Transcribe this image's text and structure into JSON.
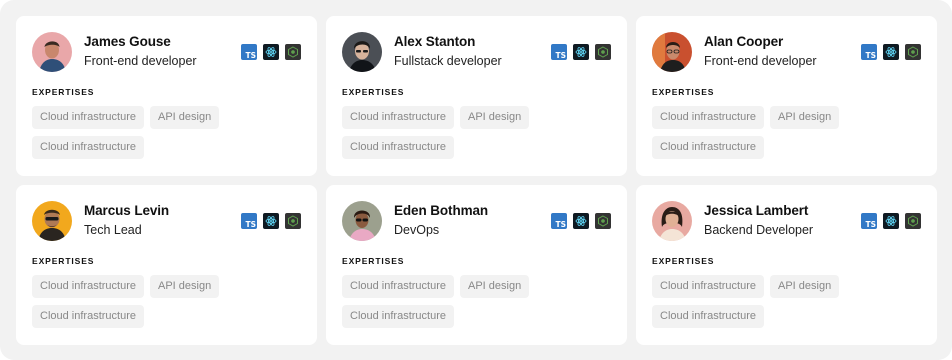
{
  "expertises_heading": "EXPERTISES",
  "tech_stack": [
    {
      "icon": "typescript-icon",
      "label": "TS",
      "color": "#3178c6"
    },
    {
      "icon": "react-icon",
      "color": "#61dafb"
    },
    {
      "icon": "nodejs-icon",
      "color": "#5fa04e"
    }
  ],
  "profiles": [
    {
      "name": "James Gouse",
      "role": "Front-end developer",
      "avatar_bg": "#e9a7a9",
      "expertises": [
        "Cloud infrastructure",
        "API design",
        "Cloud infrastructure"
      ]
    },
    {
      "name": "Alex Stanton",
      "role": "Fullstack developer",
      "avatar_bg": "#4b4f55",
      "expertises": [
        "Cloud infrastructure",
        "API design",
        "Cloud infrastructure"
      ]
    },
    {
      "name": "Alan Cooper",
      "role": "Front-end developer",
      "avatar_bg": "#c9502f",
      "expertises": [
        "Cloud infrastructure",
        "API design",
        "Cloud infrastructure"
      ]
    },
    {
      "name": "Marcus Levin",
      "role": "Tech Lead",
      "avatar_bg": "#f2a81d",
      "expertises": [
        "Cloud infrastructure",
        "API design",
        "Cloud infrastructure"
      ]
    },
    {
      "name": "Eden Bothman",
      "role": "DevOps",
      "avatar_bg": "#9ca08e",
      "expertises": [
        "Cloud infrastructure",
        "API design",
        "Cloud infrastructure"
      ]
    },
    {
      "name": "Jessica Lambert",
      "role": "Backend Developer",
      "avatar_bg": "#e8a9a1",
      "expertises": [
        "Cloud infrastructure",
        "API design",
        "Cloud infrastructure"
      ]
    }
  ]
}
